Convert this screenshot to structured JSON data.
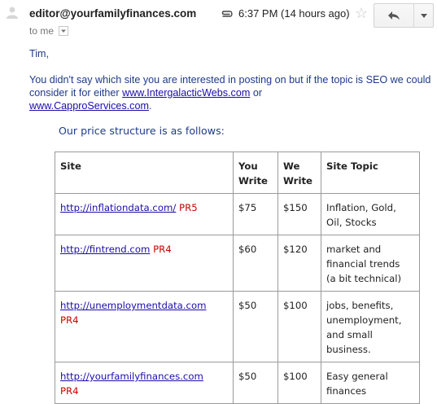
{
  "header": {
    "sender": "editor@yourfamilyfinances.com",
    "to_label": "to me",
    "time": "6:37 PM (14 hours ago)",
    "icons": [
      "avatar-icon",
      "dropdown-arrow-icon",
      "paperclip-icon",
      "star-icon",
      "reply-icon",
      "more-options-icon"
    ]
  },
  "message": {
    "greeting": "Tim,",
    "para_start": "You didn't say which site you are interested in posting on but if the topic is SEO we could consider it for either ",
    "link1": "www.IntergalacticWebs.com",
    "para_or": " or ",
    "link2": "www.CapproServices.com",
    "para_end": ".",
    "price_intro": "Our price structure is as follows:"
  },
  "table": {
    "headers": {
      "site": "Site",
      "you_write_1": "You",
      "you_write_2": "Write",
      "we_write_1": "We",
      "we_write_2": "Write",
      "topic": "Site Topic"
    },
    "rows": [
      {
        "url": "http://inflationdata.com/",
        "pr": "PR5",
        "you": "$75",
        "we": "$150",
        "topic": [
          "Inflation, Gold,",
          "Oil, Stocks"
        ]
      },
      {
        "url": "http://fintrend.com",
        "pr": "PR4",
        "you": "$60",
        "we": "$120",
        "topic": [
          "market and",
          "financial trends",
          "(a bit technical)"
        ]
      },
      {
        "url": "http://unemploymentdata.com",
        "pr": "PR4",
        "you": "$50",
        "we": "$100",
        "topic": [
          "jobs, benefits,",
          "unemployment,",
          "and small",
          "business."
        ]
      },
      {
        "url": "http://yourfamilyfinances.com",
        "pr": "PR4",
        "you": "$50",
        "we": "$100",
        "topic": [
          "Easy general",
          "finances"
        ]
      }
    ]
  },
  "colors": {
    "body_text": "#1f3a8a",
    "link": "#1a0dab",
    "pagerank": "#cc0000"
  }
}
